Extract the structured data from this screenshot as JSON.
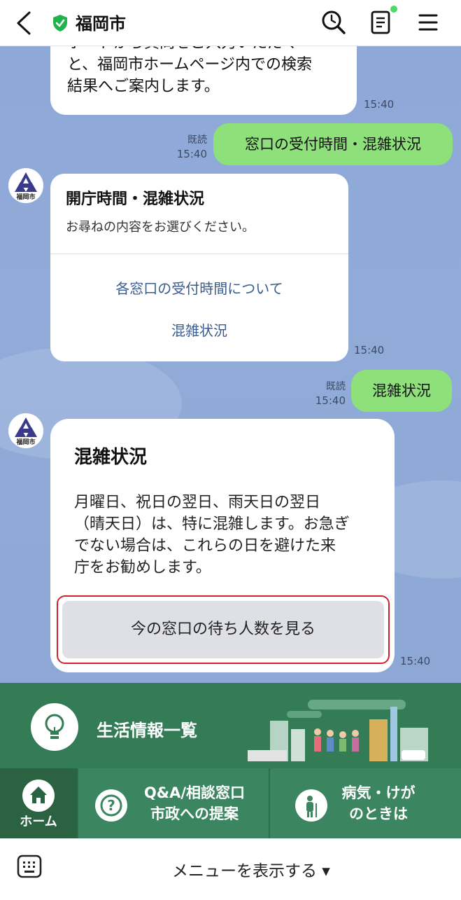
{
  "header": {
    "title": "福岡市",
    "back_icon": "chevron-left-icon",
    "search_icon": "search-icon",
    "notes_icon": "notes-icon",
    "menu_icon": "hamburger-menu-icon",
    "verified_color": "#22b24c"
  },
  "messages": {
    "prev_bot_text_line1": "ボードから質問をご入力いただく",
    "prev_bot_text_line2": "と、福岡市ホームページ内での検索",
    "prev_bot_text_line3": "結果へご案内します。",
    "prev_bot_time": "15:40",
    "user1_text": "窓口の受付時間・混雑状況",
    "user1_read": "既読",
    "user1_time": "15:40",
    "bot1_title": "開庁時間・混雑状況",
    "bot1_subtitle": "お尋ねの内容をお選びください。",
    "bot1_option1": "各窓口の受付時間について",
    "bot1_option2": "混雑状況",
    "bot1_time": "15:40",
    "user2_text": "混雑状況",
    "user2_read": "既読",
    "user2_time": "15:40",
    "bot2_title": "混雑状況",
    "bot2_body_line1": "月曜日、祝日の翌日、雨天日の翌日",
    "bot2_body_line2": "（晴天日）は、特に混雑します。お急ぎ",
    "bot2_body_line3": "でない場合は、これらの日を避けた来",
    "bot2_body_line4": "庁をお勧めします。",
    "bot2_button": "今の窓口の待ち人数を見る",
    "bot2_time": "15:40",
    "avatar_label": "福岡市"
  },
  "richmenu": {
    "living_label": "生活情報一覧",
    "home_label": "ホーム",
    "qa_line1": "Q&A/相談窓口",
    "qa_line2": "市政への提案",
    "sick_line1": "病気・けが",
    "sick_line2": "のときは"
  },
  "bottombar": {
    "keyboard_icon": "keyboard-icon",
    "menu_text": "メニューを表示する ▾"
  },
  "colors": {
    "user_bubble": "#8ee07a",
    "link_text": "#3a5b8c",
    "menu_green": "#337c56",
    "highlight_border": "#d0222a"
  }
}
